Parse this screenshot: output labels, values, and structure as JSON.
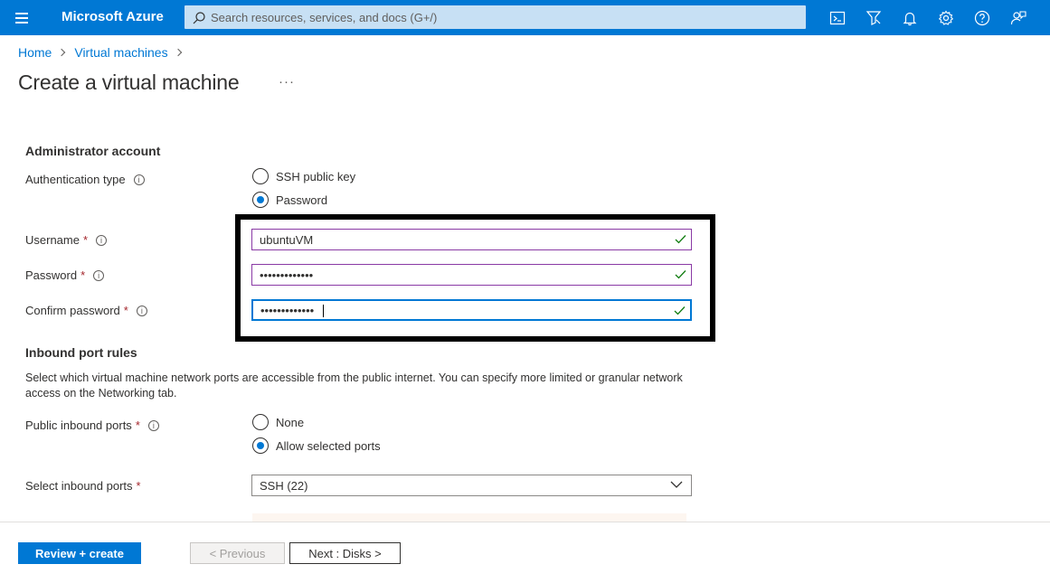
{
  "topbar": {
    "brand": "Microsoft Azure",
    "search_placeholder": "Search resources, services, and docs (G+/)",
    "icons": [
      "cloud-shell-icon",
      "directory-filter-icon",
      "notifications-bell-icon",
      "settings-gear-icon",
      "help-question-icon",
      "feedback-icon"
    ]
  },
  "breadcrumb": {
    "home": "Home",
    "vms": "Virtual machines"
  },
  "page": {
    "title": "Create a virtual machine",
    "more": "···"
  },
  "admin": {
    "title": "Administrator account",
    "auth_label": "Authentication type",
    "auth_options": [
      "SSH public key",
      "Password"
    ],
    "auth_selected": "Password",
    "username_label": "Username",
    "username_value": "ubuntuVM",
    "password_label": "Password",
    "password_mask": "•••••••••••••",
    "confirm_label": "Confirm password",
    "confirm_mask": "•••••••••••••",
    "required": "*",
    "info_glyph": "i"
  },
  "inbound": {
    "title": "Inbound port rules",
    "description": "Select which virtual machine network ports are accessible from the public internet. You can specify more limited or granular network access on the Networking tab.",
    "public_label": "Public inbound ports",
    "public_options": [
      "None",
      "Allow selected ports"
    ],
    "public_selected": "Allow selected ports",
    "select_label": "Select inbound ports",
    "select_value": "SSH (22)"
  },
  "footer": {
    "review": "Review + create",
    "previous": "< Previous",
    "next": "Next : Disks >"
  },
  "colors": {
    "azure_blue": "#0078d4",
    "valid_green": "#107c10",
    "required_red": "#a4262c"
  }
}
